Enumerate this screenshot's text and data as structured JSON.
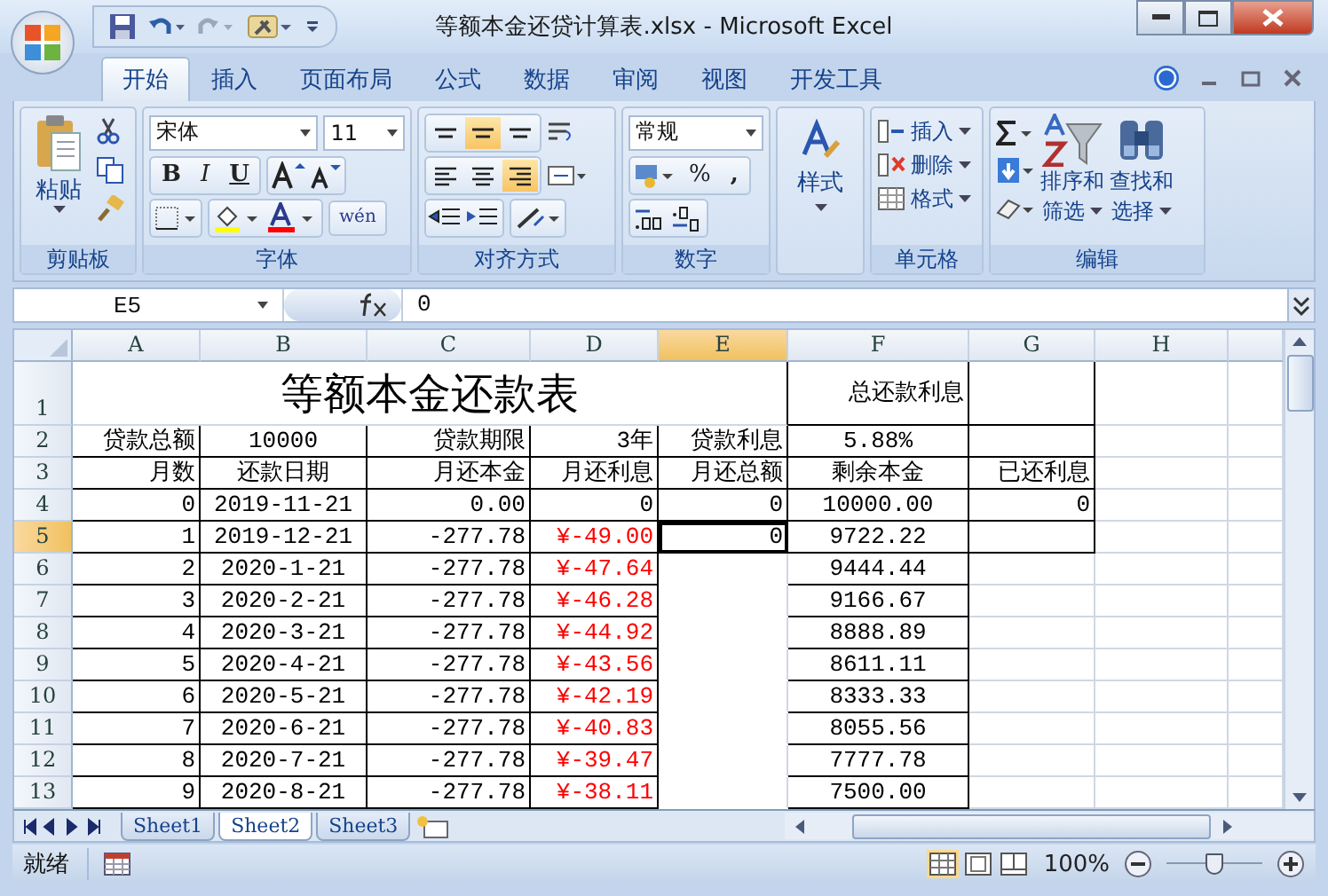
{
  "window": {
    "title": "等额本金还贷计算表.xlsx - Microsoft Excel"
  },
  "tabs": [
    {
      "label": "开始",
      "selected": true
    },
    {
      "label": "插入",
      "selected": false
    },
    {
      "label": "页面布局",
      "selected": false
    },
    {
      "label": "公式",
      "selected": false
    },
    {
      "label": "数据",
      "selected": false
    },
    {
      "label": "审阅",
      "selected": false
    },
    {
      "label": "视图",
      "selected": false
    },
    {
      "label": "开发工具",
      "selected": false
    }
  ],
  "ribbon": {
    "clipboard": {
      "title": "剪贴板",
      "paste": "粘贴"
    },
    "font": {
      "title": "字体",
      "font_name": "宋体",
      "font_size": "11",
      "bold": "B",
      "italic": "I",
      "underline": "U",
      "phonetic": "wén"
    },
    "alignment": {
      "title": "对齐方式",
      "vertical": [
        {
          "selected": false
        },
        {
          "selected": true
        },
        {
          "selected": false
        }
      ],
      "horizontal": [
        {
          "selected": false
        },
        {
          "selected": false
        },
        {
          "selected": true
        }
      ]
    },
    "number": {
      "title": "数字",
      "format": "常规",
      "percent": "%",
      "comma": ","
    },
    "styles": {
      "label": "样式"
    },
    "cells": {
      "title": "单元格",
      "insert": "插入",
      "delete": "删除",
      "format": "格式"
    },
    "editing": {
      "title": "编辑",
      "sort": [
        "排序和",
        "筛选"
      ],
      "find": [
        "查找和",
        "选择"
      ]
    }
  },
  "formula_bar": {
    "name_box": "E5",
    "formula": "0"
  },
  "sheet": {
    "columns": [
      {
        "label": "A",
        "selected": false
      },
      {
        "label": "B",
        "selected": false
      },
      {
        "label": "C",
        "selected": false
      },
      {
        "label": "D",
        "selected": false
      },
      {
        "label": "E",
        "selected": true
      },
      {
        "label": "F",
        "selected": false
      },
      {
        "label": "G",
        "selected": false
      },
      {
        "label": "H",
        "selected": false
      }
    ],
    "rows": [
      {
        "label": "1",
        "selected": false,
        "title": "等额本金还款表",
        "cells": {
          "F": "总还款利息"
        }
      },
      {
        "label": "2",
        "selected": false,
        "cells": {
          "A": "贷款总额",
          "B": "10000",
          "C": "贷款期限",
          "D": "3年",
          "E": "贷款利息",
          "F": "5.88%"
        }
      },
      {
        "label": "3",
        "selected": false,
        "cells": {
          "A": "月数",
          "B": "还款日期",
          "C": "月还本金",
          "D": "月还利息",
          "E": "月还总额",
          "F": "剩余本金",
          "G": "已还利息"
        }
      },
      {
        "label": "4",
        "selected": false,
        "cells": {
          "A": "0",
          "B": "2019-11-21",
          "C": "0.00",
          "D": "0",
          "E": "0",
          "F": "10000.00",
          "G": "0"
        }
      },
      {
        "label": "5",
        "selected": true,
        "cells": {
          "A": "1",
          "B": "2019-12-21",
          "C": "-277.78",
          "D": {
            "text": "¥-49.00",
            "red": true
          },
          "E": "0",
          "F": "9722.22"
        }
      },
      {
        "label": "6",
        "selected": false,
        "cells": {
          "A": "2",
          "B": "2020-1-21",
          "C": "-277.78",
          "D": {
            "text": "¥-47.64",
            "red": true
          },
          "F": "9444.44"
        }
      },
      {
        "label": "7",
        "selected": false,
        "cells": {
          "A": "3",
          "B": "2020-2-21",
          "C": "-277.78",
          "D": {
            "text": "¥-46.28",
            "red": true
          },
          "F": "9166.67"
        }
      },
      {
        "label": "8",
        "selected": false,
        "cells": {
          "A": "4",
          "B": "2020-3-21",
          "C": "-277.78",
          "D": {
            "text": "¥-44.92",
            "red": true
          },
          "F": "8888.89"
        }
      },
      {
        "label": "9",
        "selected": false,
        "cells": {
          "A": "5",
          "B": "2020-4-21",
          "C": "-277.78",
          "D": {
            "text": "¥-43.56",
            "red": true
          },
          "F": "8611.11"
        }
      },
      {
        "label": "10",
        "selected": false,
        "cells": {
          "A": "6",
          "B": "2020-5-21",
          "C": "-277.78",
          "D": {
            "text": "¥-42.19",
            "red": true
          },
          "F": "8333.33"
        }
      },
      {
        "label": "11",
        "selected": false,
        "cells": {
          "A": "7",
          "B": "2020-6-21",
          "C": "-277.78",
          "D": {
            "text": "¥-40.83",
            "red": true
          },
          "F": "8055.56"
        }
      },
      {
        "label": "12",
        "selected": false,
        "cells": {
          "A": "8",
          "B": "2020-7-21",
          "C": "-277.78",
          "D": {
            "text": "¥-39.47",
            "red": true
          },
          "F": "7777.78"
        }
      },
      {
        "label": "13",
        "selected": false,
        "cells": {
          "A": "9",
          "B": "2020-8-21",
          "C": "-277.78",
          "D": {
            "text": "¥-38.11",
            "red": true
          },
          "F": "7500.00"
        }
      }
    ]
  },
  "sheet_tabs": [
    {
      "label": "Sheet1",
      "selected": false
    },
    {
      "label": "Sheet2",
      "selected": true
    },
    {
      "label": "Sheet3",
      "selected": false
    }
  ],
  "status_bar": {
    "status": "就绪",
    "zoom": "100%",
    "zoom_slider": {
      "level": 0.5
    }
  }
}
